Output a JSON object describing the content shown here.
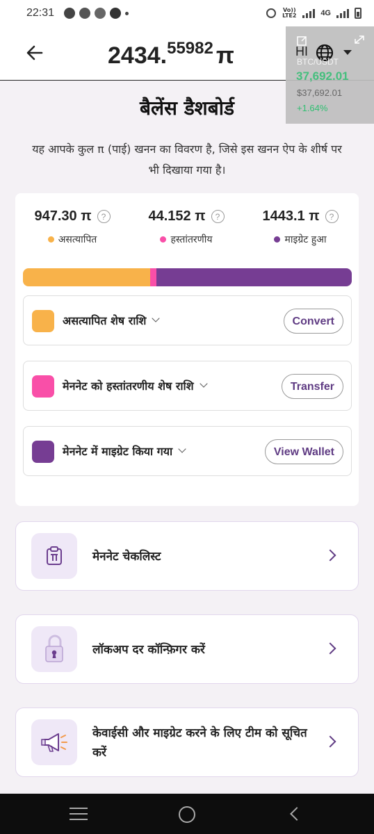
{
  "status_bar": {
    "time": "22:31",
    "network": "4G",
    "volte": "Vo)) LTE2"
  },
  "header": {
    "balance_int": "2434.",
    "balance_dec": "55982",
    "unit": "π"
  },
  "ticker": {
    "lang": "HI",
    "pair": "BTC/USDT",
    "price_big": "37,692.01",
    "price": "$37,692.01",
    "change": "+1.64%"
  },
  "page": {
    "title": "बैलेंस डैशबोर्ड",
    "intro": "यह आपके कुल π (पाई) खनन का विवरण है, जिसे इस खनन ऐप के शीर्ष पर भी दिखाया गया है।"
  },
  "stats": [
    {
      "value": "947.30 π",
      "label": "असत्यापित",
      "color": "#f8b24a"
    },
    {
      "value": "44.152 π",
      "label": "हस्तांतरणीय",
      "color": "#f94fa8"
    },
    {
      "value": "1443.1 π",
      "label": "माइग्रेट हुआ",
      "color": "#763d93"
    }
  ],
  "progress": [
    {
      "fraction": 0.3879,
      "color": "#f8b24a"
    },
    {
      "fraction": 0.0181,
      "color": "#f94fa8"
    },
    {
      "fraction": 0.594,
      "color": "#763d93"
    }
  ],
  "rows": [
    {
      "label": "असत्यापित शेष राशि",
      "button": "Convert",
      "color": "#f8b24a"
    },
    {
      "label": "मेननेट को हस्तांतरणीय शेष राशि",
      "button": "Transfer",
      "color": "#f94fa8"
    },
    {
      "label": "मेननेट में माइग्रेट किया गया",
      "button": "View Wallet",
      "color": "#763d93"
    }
  ],
  "links": [
    {
      "label": "मेननेट चेकलिस्ट",
      "icon": "clipboard-pi-icon"
    },
    {
      "label": "लॉकअप दर कॉन्फ़िगर करें",
      "icon": "padlock-icon"
    },
    {
      "label": "केवाईसी और माइग्रेट करने के लिए टीम को सूचित करें",
      "icon": "megaphone-icon"
    }
  ]
}
